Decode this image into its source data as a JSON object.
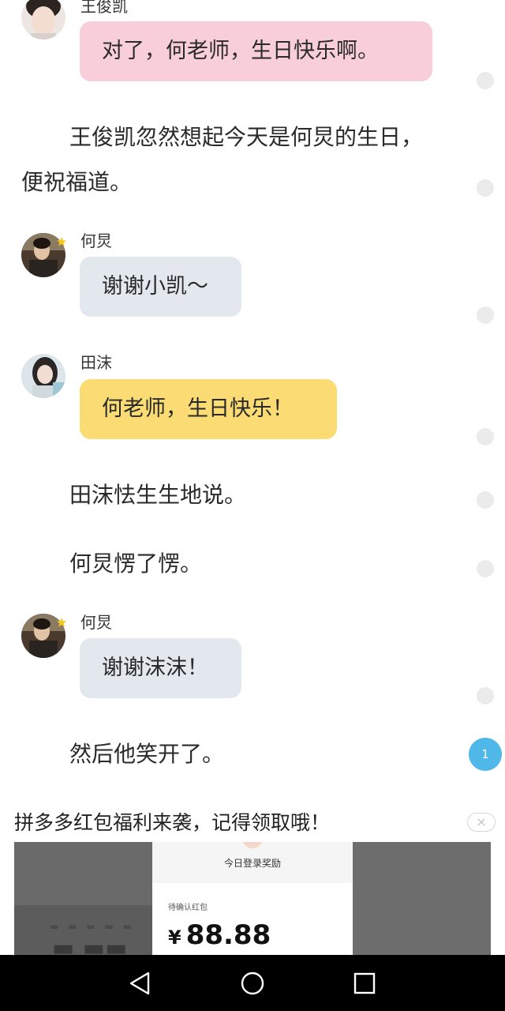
{
  "messages": [
    {
      "speaker": "王俊凯",
      "text": "对了，何老师，生日快乐啊。"
    },
    {
      "speaker": "何炅",
      "text": "谢谢小凯～"
    },
    {
      "speaker": "田沫",
      "text": "何老师，生日快乐！"
    },
    {
      "speaker": "何炅",
      "text": "谢谢沫沫！"
    }
  ],
  "narration": {
    "line1a": "王俊凯忽然想起今天是何炅的生日，",
    "line1b": "便祝福道。",
    "line2": "田沫怯生生地说。",
    "line3": "何炅愣了愣。",
    "line4": "然后他笑开了。"
  },
  "comment_badge": "1",
  "ad": {
    "title": "拼多多红包福利来袭，记得领取哦！",
    "close": "×",
    "card_heading": "今日登录奖励",
    "pending_label": "待确认红包",
    "currency": "¥",
    "amount": "88.88"
  },
  "colors": {
    "bubble_pink": "#f8cfd9",
    "bubble_gray": "#e3e7ee",
    "bubble_yellow": "#fbdc74",
    "badge_blue": "#4fb8e8"
  },
  "icons": {
    "nav_back": "triangle-back-icon",
    "nav_home": "circle-home-icon",
    "nav_recent": "square-recent-icon"
  }
}
